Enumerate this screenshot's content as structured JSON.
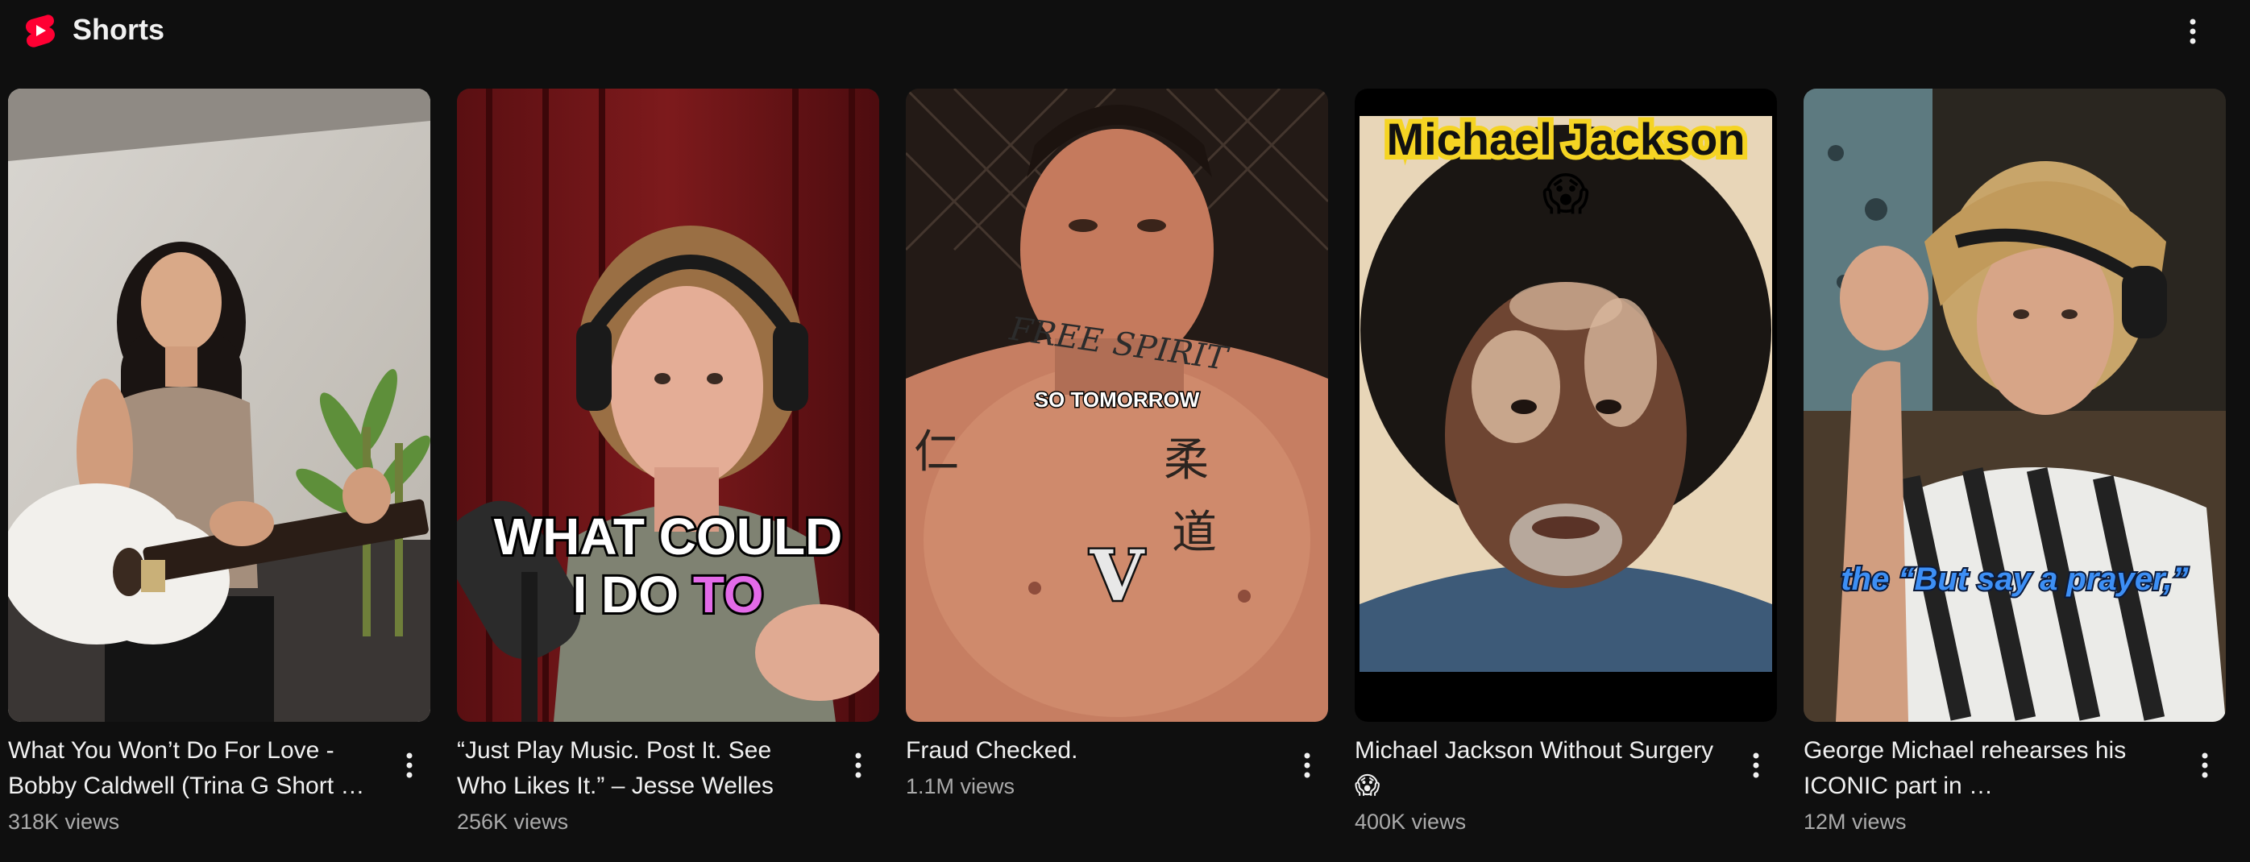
{
  "shelf": {
    "title": "Shorts",
    "logo_icon": "youtube-shorts-icon",
    "menu_icon": "more-vert-icon",
    "brand_color": "#ff0033"
  },
  "cards": [
    {
      "title": "What You Won’t Do For Love - Bobby Caldwell (Trina G Short …",
      "views": "318K views",
      "menu_icon": "more-vert-icon"
    },
    {
      "title": "“Just Play Music. Post It. See Who Likes It.” – Jesse Welles",
      "views": "256K views",
      "menu_icon": "more-vert-icon",
      "overlay_line1": "WHAT COULD",
      "overlay_line2_a": "I DO ",
      "overlay_line2_b": "TO",
      "overlay_accent": "#e36ae8"
    },
    {
      "title": "Fraud Checked.",
      "views": "1.1M views",
      "menu_icon": "more-vert-icon",
      "overlay_caption": "SO TOMORROW",
      "overlay_logo": "V",
      "tattoo_text": "FREE SPIRIT"
    },
    {
      "title": "Michael Jackson Without Surgery 😱",
      "views": "400K views",
      "menu_icon": "more-vert-icon",
      "overlay_title": "Michael Jackson",
      "overlay_emoji": "😱",
      "overlay_title_color": "#f5d423"
    },
    {
      "title": "George Michael rehearses his ICONIC part in …",
      "views": "12M views",
      "menu_icon": "more-vert-icon",
      "overlay_caption": "the “But say a prayer,”",
      "overlay_caption_color": "#3d8ff5"
    }
  ]
}
